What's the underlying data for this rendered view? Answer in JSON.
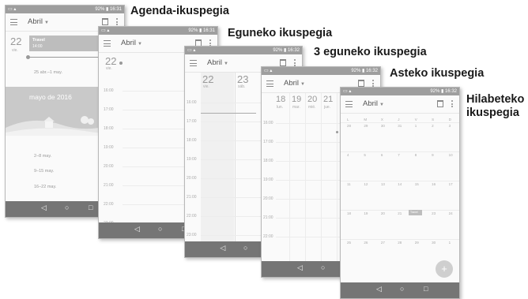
{
  "labels": {
    "agenda": "Agenda-ikuspegia",
    "day": "Eguneko ikuspegia",
    "three_day": "3 eguneko ikuspegia",
    "week": "Asteko ikuspegia",
    "month_line1": "Hilabeteko",
    "month_line2": "ikuspegia"
  },
  "status": {
    "time1": "92% ▮ 16:31",
    "time2": "92% ▮ 16:31",
    "time3": "92% ▮ 16:32",
    "time4": "92% ▮ 16:32",
    "time5": "92% ▮ 16:32"
  },
  "month_name": "Abril",
  "agenda": {
    "day_num": "22",
    "day_name": "vie.",
    "event_title": "Travel",
    "event_time": "14:00",
    "range1": "25 abr.–1 may.",
    "month_banner": "mayo de 2016",
    "week1": "2–8 may.",
    "week2": "9–15 may.",
    "week3": "16–22 may."
  },
  "day_view": {
    "day_num": "22",
    "day_name": "vie.",
    "hours": [
      "16:00",
      "17:00",
      "18:00",
      "19:00",
      "20:00",
      "21:00",
      "22:00",
      "23:00",
      "0:00"
    ]
  },
  "three_day": {
    "d1_num": "22",
    "d1_name": "vie.",
    "d2_num": "23",
    "d2_name": "sáb.",
    "hours": [
      "16:00",
      "17:00",
      "18:00",
      "19:00",
      "20:00",
      "21:00",
      "22:00",
      "23:00"
    ]
  },
  "week_view": {
    "days": [
      {
        "num": "18",
        "name": "lun."
      },
      {
        "num": "19",
        "name": "mar."
      },
      {
        "num": "20",
        "name": "mié."
      },
      {
        "num": "21",
        "name": "jue."
      }
    ],
    "hours": [
      "16:00",
      "17:00",
      "18:00",
      "19:00",
      "20:00",
      "21:00",
      "22:00"
    ]
  },
  "month_view": {
    "headers": [
      "L",
      "M",
      "X",
      "J",
      "V",
      "S",
      "D"
    ],
    "rows": [
      [
        "28",
        "29",
        "30",
        "31",
        "1",
        "2",
        "3"
      ],
      [
        "4",
        "5",
        "6",
        "7",
        "8",
        "9",
        "10"
      ],
      [
        "11",
        "12",
        "13",
        "14",
        "15",
        "16",
        "17"
      ],
      [
        "18",
        "19",
        "20",
        "21",
        "22",
        "23",
        "24"
      ],
      [
        "25",
        "26",
        "27",
        "28",
        "29",
        "30",
        "1"
      ]
    ],
    "event_label": "Travel"
  },
  "fab_label": "+",
  "nav": {
    "back": "◁",
    "home": "○",
    "recent": "□"
  }
}
